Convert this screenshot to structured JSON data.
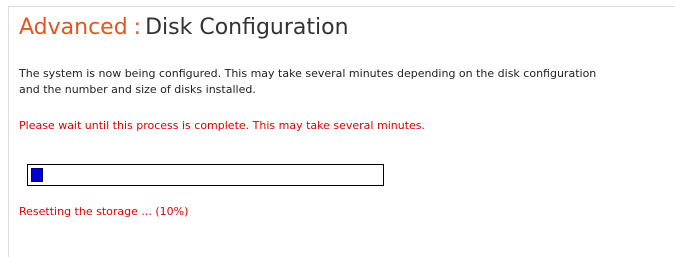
{
  "header": {
    "section": "Advanced",
    "separator": ":",
    "page": "Disk Configuration"
  },
  "message": {
    "description": "The system is now being configured. This may take several minutes depending on the disk configuration and the number and size of disks installed.",
    "warning": "Please wait until this process is complete. This may take several minutes."
  },
  "progress": {
    "percent": 10,
    "status": "Resetting the storage ... (10%)"
  },
  "colors": {
    "section_title": "#e0561f",
    "warning_text": "#e00000",
    "progress_fill": "#0000d8"
  }
}
